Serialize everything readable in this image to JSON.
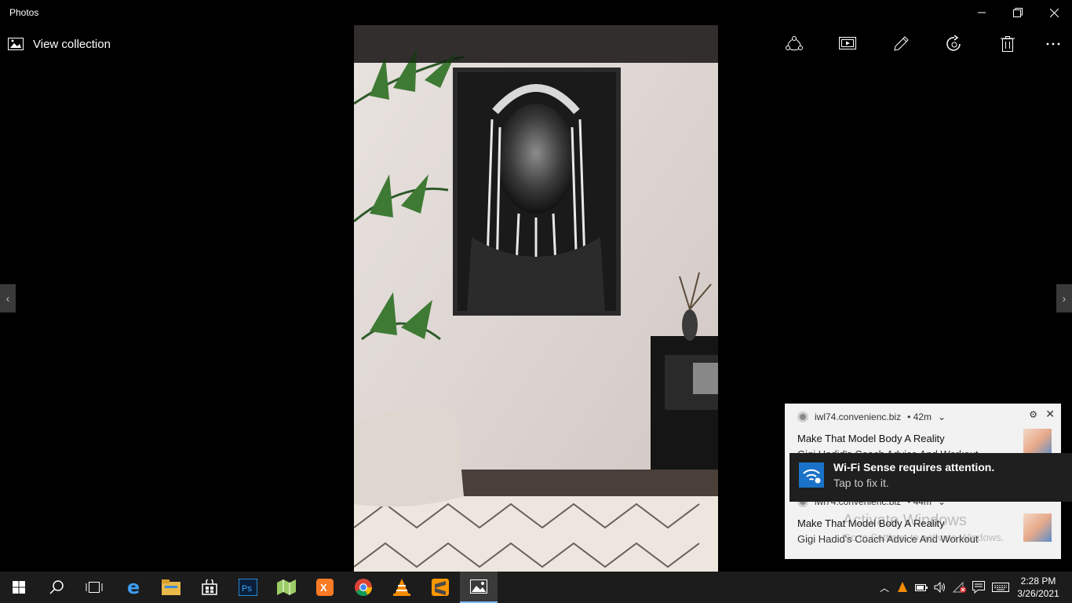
{
  "window": {
    "title": "Photos",
    "minimize_icon": "minimize-icon",
    "restore_icon": "restore-icon",
    "close_icon": "close-icon"
  },
  "toolbar": {
    "view_collection_label": "View collection",
    "tools": [
      "share-icon",
      "slideshow-icon",
      "edit-icon",
      "rotate-icon",
      "delete-icon",
      "more-icon"
    ]
  },
  "navigation": {
    "prev_glyph": "‹",
    "next_glyph": "›"
  },
  "notifications": [
    {
      "source": "iwl74.convenienc.biz",
      "age": "• 42m",
      "headline": "Make That Model Body A Reality",
      "body": "Gigi Hadid's Coach Advice And Workout"
    },
    {
      "source": "iwl74.convenienc.biz",
      "age": "• 44m",
      "headline": "Make That Model Body A Reality",
      "body": "Gigi Hadid's Coach Advice And Workout"
    }
  ],
  "wifi_toast": {
    "title": "Wi-Fi Sense requires attention.",
    "subtitle": "Tap to fix it."
  },
  "watermark": {
    "line1": "Activate Windows",
    "line2": "Go to Settings to activate Windows."
  },
  "taskbar": {
    "apps": [
      "start-icon",
      "search-icon",
      "task-view-icon",
      "edge-icon",
      "file-explorer-icon",
      "store-icon",
      "photoshop-icon",
      "maps-icon",
      "xampp-icon",
      "chrome-icon",
      "vlc-icon",
      "sublime-icon",
      "photos-icon"
    ],
    "active_app": "photos-icon"
  },
  "clock": {
    "time": "2:28 PM",
    "date": "3/26/2021"
  },
  "colors": {
    "accent": "#1a73c8",
    "taskbar": "#1c1c1c",
    "toast_bg": "#f2f2f2"
  }
}
